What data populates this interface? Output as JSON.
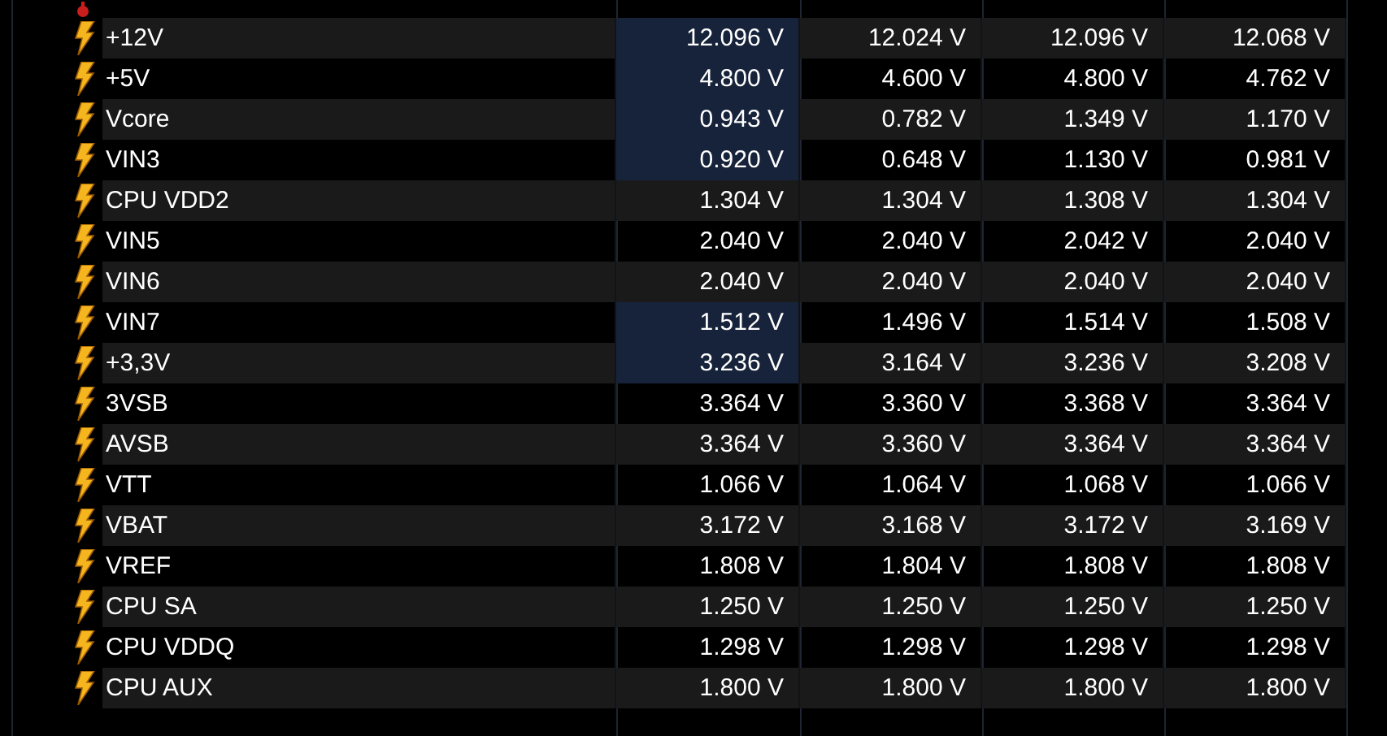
{
  "sensors": [
    {
      "name": "+12V",
      "highlighted": true,
      "values": [
        "12.096 V",
        "12.024 V",
        "12.096 V",
        "12.068 V"
      ]
    },
    {
      "name": "+5V",
      "highlighted": true,
      "values": [
        "4.800 V",
        "4.600 V",
        "4.800 V",
        "4.762 V"
      ]
    },
    {
      "name": "Vcore",
      "highlighted": true,
      "values": [
        "0.943 V",
        "0.782 V",
        "1.349 V",
        "1.170 V"
      ]
    },
    {
      "name": "VIN3",
      "highlighted": true,
      "values": [
        "0.920 V",
        "0.648 V",
        "1.130 V",
        "0.981 V"
      ]
    },
    {
      "name": "CPU VDD2",
      "highlighted": false,
      "values": [
        "1.304 V",
        "1.304 V",
        "1.308 V",
        "1.304 V"
      ]
    },
    {
      "name": "VIN5",
      "highlighted": false,
      "values": [
        "2.040 V",
        "2.040 V",
        "2.042 V",
        "2.040 V"
      ]
    },
    {
      "name": "VIN6",
      "highlighted": false,
      "values": [
        "2.040 V",
        "2.040 V",
        "2.040 V",
        "2.040 V"
      ]
    },
    {
      "name": "VIN7",
      "highlighted": true,
      "values": [
        "1.512 V",
        "1.496 V",
        "1.514 V",
        "1.508 V"
      ]
    },
    {
      "name": "+3,3V",
      "highlighted": true,
      "values": [
        "3.236 V",
        "3.164 V",
        "3.236 V",
        "3.208 V"
      ]
    },
    {
      "name": "3VSB",
      "highlighted": false,
      "values": [
        "3.364 V",
        "3.360 V",
        "3.368 V",
        "3.364 V"
      ]
    },
    {
      "name": "AVSB",
      "highlighted": false,
      "values": [
        "3.364 V",
        "3.360 V",
        "3.364 V",
        "3.364 V"
      ]
    },
    {
      "name": "VTT",
      "highlighted": false,
      "values": [
        "1.066 V",
        "1.064 V",
        "1.068 V",
        "1.066 V"
      ]
    },
    {
      "name": "VBAT",
      "highlighted": false,
      "values": [
        "3.172 V",
        "3.168 V",
        "3.172 V",
        "3.169 V"
      ]
    },
    {
      "name": "VREF",
      "highlighted": false,
      "values": [
        "1.808 V",
        "1.804 V",
        "1.808 V",
        "1.808 V"
      ]
    },
    {
      "name": "CPU SA",
      "highlighted": false,
      "values": [
        "1.250 V",
        "1.250 V",
        "1.250 V",
        "1.250 V"
      ]
    },
    {
      "name": "CPU VDDQ",
      "highlighted": false,
      "values": [
        "1.298 V",
        "1.298 V",
        "1.298 V",
        "1.298 V"
      ]
    },
    {
      "name": "CPU AUX",
      "highlighted": false,
      "values": [
        "1.800 V",
        "1.800 V",
        "1.800 V",
        "1.800 V"
      ]
    }
  ]
}
